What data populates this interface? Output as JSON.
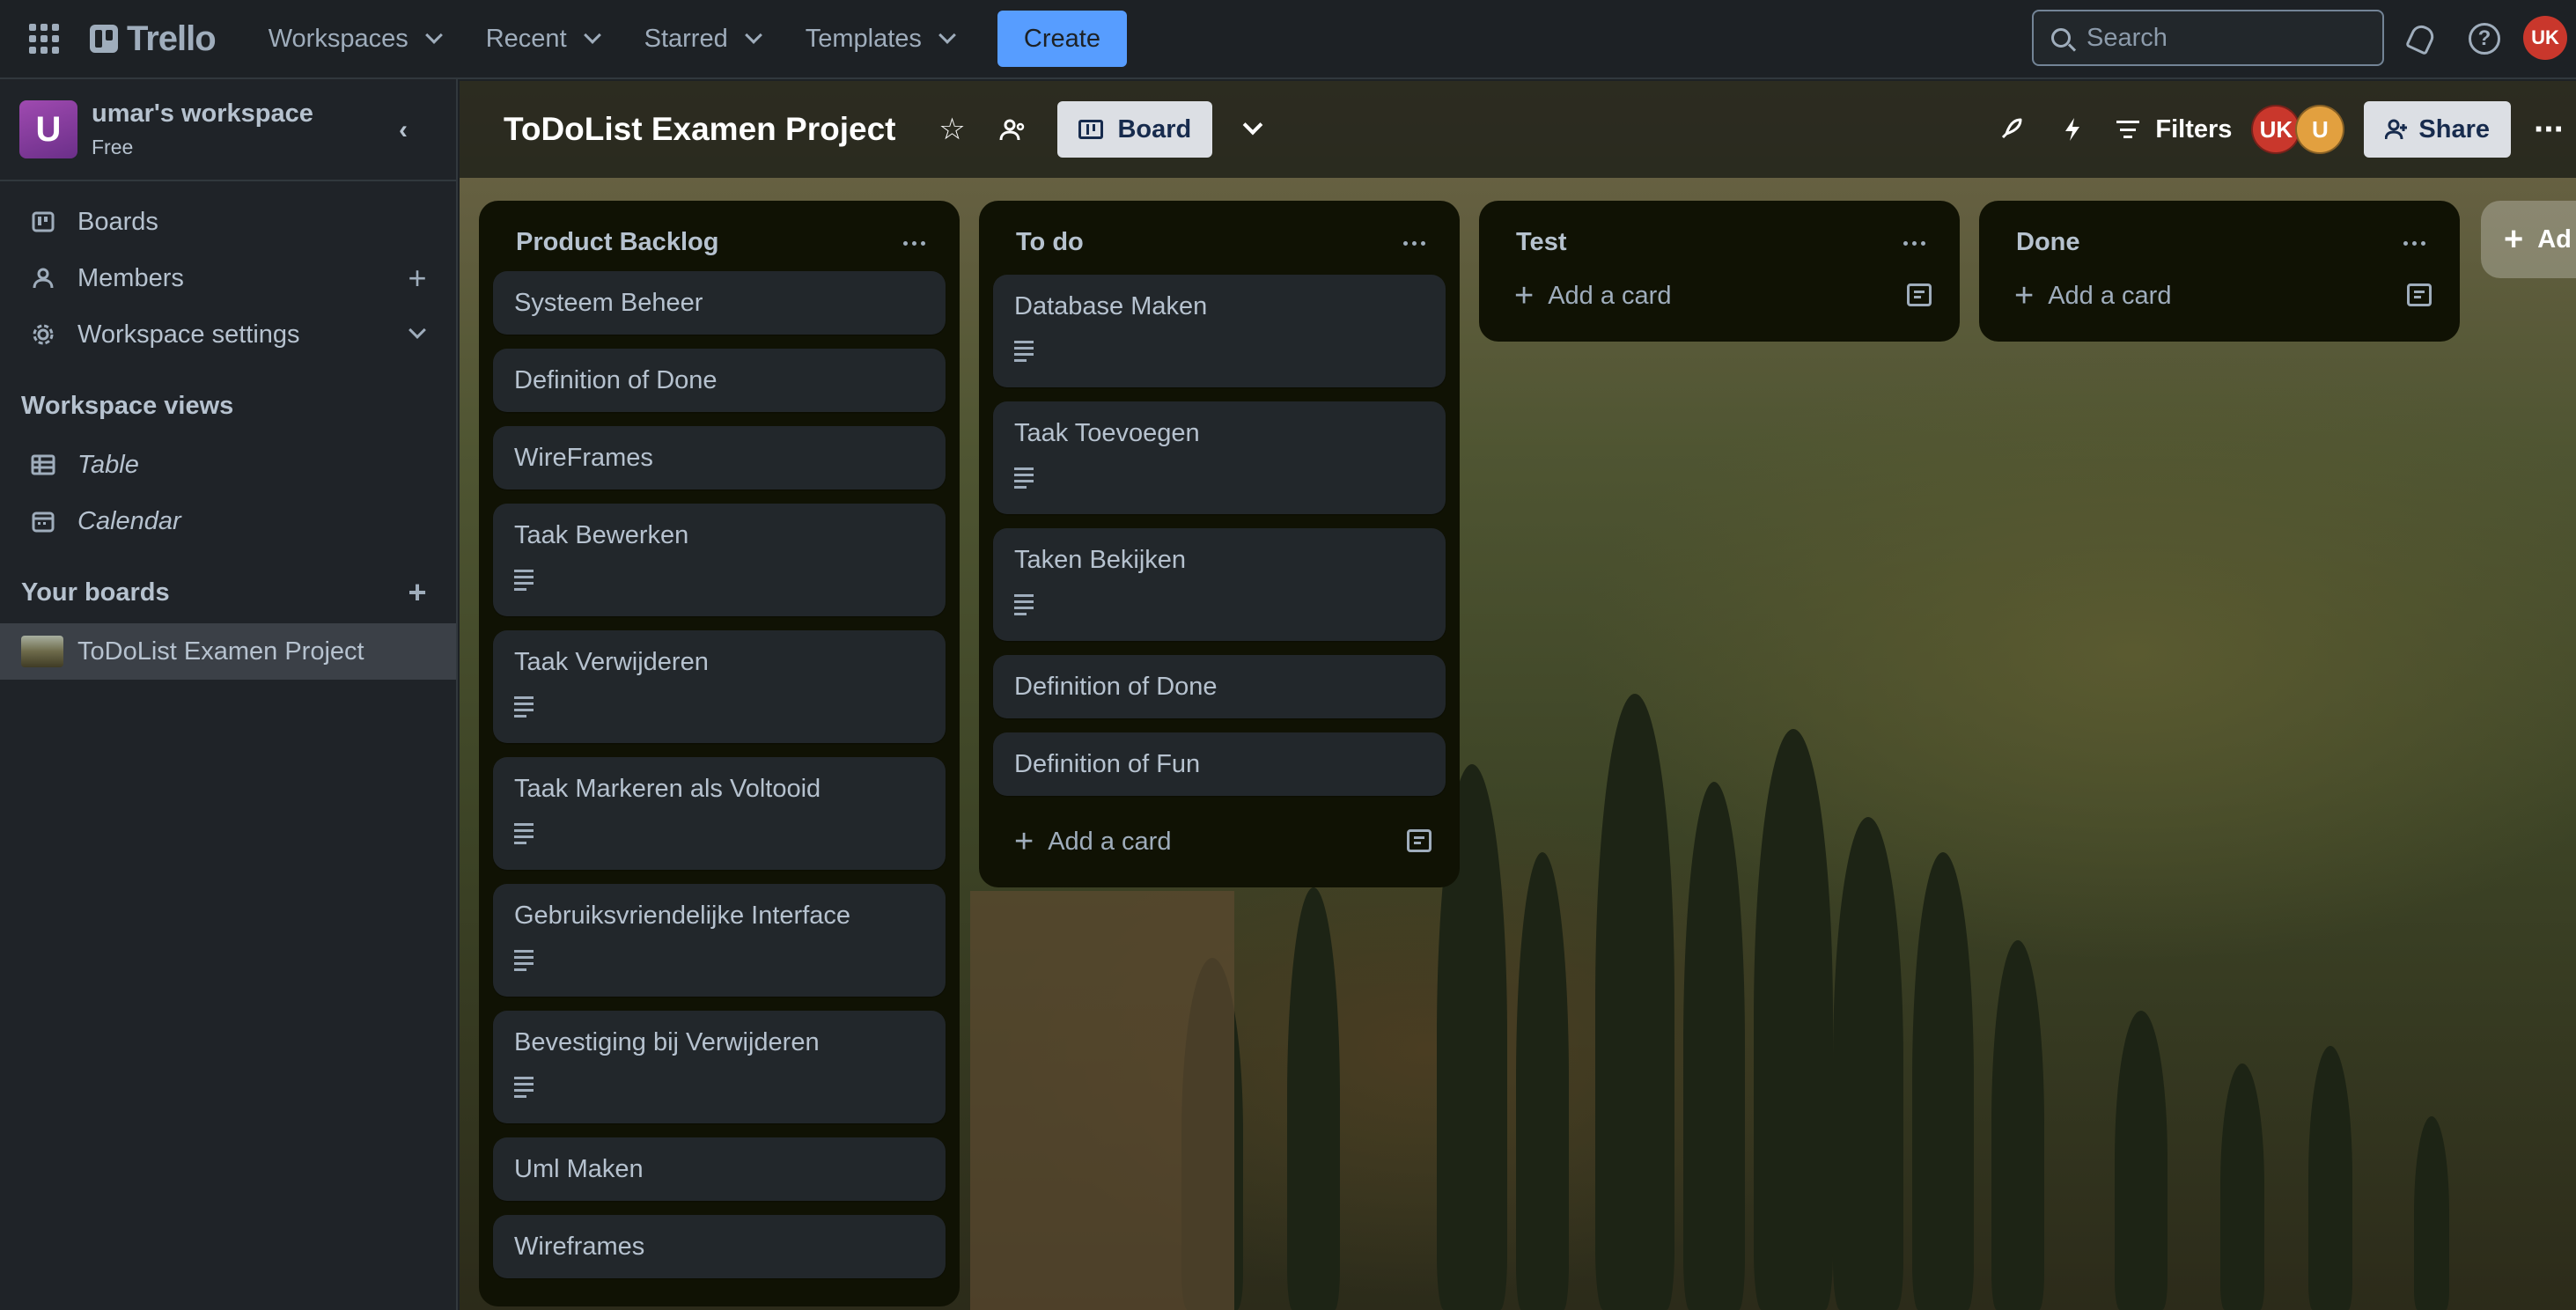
{
  "topbar": {
    "logo": "Trello",
    "nav": [
      {
        "label": "Workspaces"
      },
      {
        "label": "Recent"
      },
      {
        "label": "Starred"
      },
      {
        "label": "Templates"
      }
    ],
    "create_label": "Create",
    "search_placeholder": "Search",
    "user_initials": "UK",
    "help_glyph": "?"
  },
  "sidebar": {
    "workspace_initial": "U",
    "workspace_name": "umar's workspace",
    "workspace_plan": "Free",
    "items": [
      {
        "label": "Boards",
        "icon": "board-icon"
      },
      {
        "label": "Members",
        "icon": "person-icon"
      },
      {
        "label": "Workspace settings",
        "icon": "gear-icon"
      }
    ],
    "views_heading": "Workspace views",
    "views": [
      {
        "label": "Table",
        "icon": "table-icon"
      },
      {
        "label": "Calendar",
        "icon": "calendar-icon"
      }
    ],
    "boards_heading": "Your boards",
    "boards": [
      {
        "label": "ToDoList Examen Project"
      }
    ]
  },
  "board": {
    "title": "ToDoList Examen Project",
    "view_label": "Board",
    "filters_label": "Filters",
    "members": [
      {
        "initials": "UK",
        "color": "#c9372c"
      },
      {
        "initials": "U",
        "color": "#e2a03f"
      }
    ],
    "share_label": "Share"
  },
  "lists": [
    {
      "title": "Product Backlog",
      "cards": [
        {
          "title": "Systeem Beheer",
          "has_description": false
        },
        {
          "title": "Definition of Done",
          "has_description": false
        },
        {
          "title": "WireFrames",
          "has_description": false
        },
        {
          "title": "Taak Bewerken",
          "has_description": true
        },
        {
          "title": "Taak Verwijderen",
          "has_description": true
        },
        {
          "title": "Taak Markeren als Voltooid",
          "has_description": true
        },
        {
          "title": "Gebruiksvriendelijke Interface",
          "has_description": true
        },
        {
          "title": "Bevestiging bij Verwijderen",
          "has_description": true
        },
        {
          "title": "Uml Maken",
          "has_description": false
        },
        {
          "title": "Wireframes",
          "has_description": false
        }
      ]
    },
    {
      "title": "To do",
      "cards": [
        {
          "title": "Database Maken",
          "has_description": true
        },
        {
          "title": "Taak Toevoegen",
          "has_description": true
        },
        {
          "title": "Taken Bekijken",
          "has_description": true
        },
        {
          "title": "Definition of Done",
          "has_description": false
        },
        {
          "title": "Definition of Fun",
          "has_description": false
        }
      ],
      "add_card_label": "Add a card"
    },
    {
      "title": "Test",
      "cards": [],
      "add_card_label": "Add a card"
    },
    {
      "title": "Done",
      "cards": [],
      "add_card_label": "Add a card"
    }
  ],
  "add_list_label": "Ad"
}
